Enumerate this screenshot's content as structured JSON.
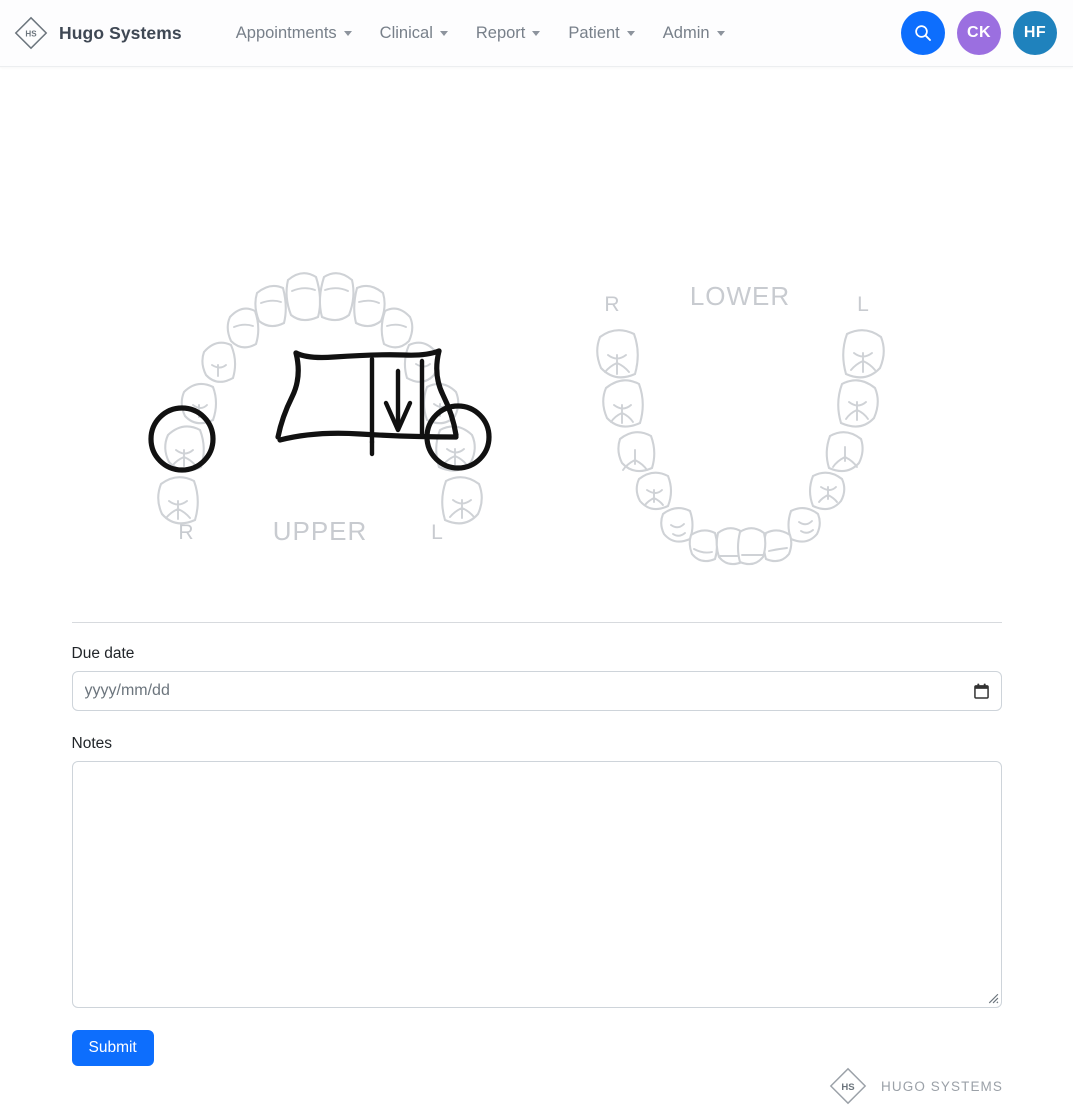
{
  "navbar": {
    "brand": {
      "name": "Hugo Systems",
      "logo_initials": "HS",
      "icon": "diamond-logo-icon"
    },
    "items": [
      {
        "label": "Appointments",
        "caret": true
      },
      {
        "label": "Clinical",
        "caret": true
      },
      {
        "label": "Report",
        "caret": true
      },
      {
        "label": "Patient",
        "caret": true
      },
      {
        "label": "Admin",
        "caret": true
      }
    ],
    "actions": {
      "search": {
        "icon": "search-icon",
        "color": "#0d6efd"
      },
      "avatar_one": {
        "initials": "CK",
        "color": "#9b6fe0"
      },
      "avatar_two": {
        "initials": "HF",
        "color": "#1f82bd"
      }
    }
  },
  "chart": {
    "upper": {
      "label": "UPPER",
      "right_label": "R",
      "left_label": "L",
      "annotated": true
    },
    "lower": {
      "label": "LOWER",
      "right_label": "R",
      "left_label": "L",
      "annotated": false
    },
    "tooth_color": "#cfd2d6",
    "annotation_color": "#111111"
  },
  "form": {
    "due_date": {
      "label": "Due date",
      "placeholder": "yyyy/mm/dd",
      "value": "",
      "icon": "calendar-icon"
    },
    "notes": {
      "label": "Notes",
      "value": "",
      "placeholder": ""
    },
    "submit_label": "Submit"
  },
  "footer": {
    "logo_initials": "HS",
    "name": "HUGO SYSTEMS"
  }
}
